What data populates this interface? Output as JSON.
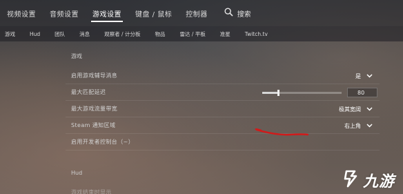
{
  "top_nav": {
    "tabs": [
      {
        "label": "视频设置",
        "active": false
      },
      {
        "label": "音频设置",
        "active": false
      },
      {
        "label": "游戏设置",
        "active": true
      },
      {
        "label": "键盘 / 鼠标",
        "active": false
      },
      {
        "label": "控制器",
        "active": false
      }
    ],
    "search_label": "搜索"
  },
  "sub_nav": {
    "tabs": [
      "游戏",
      "Hud",
      "团队",
      "消息",
      "观察者 / 计分板",
      "物品",
      "雷达 / 平板",
      "准星",
      "Twitch.tv"
    ]
  },
  "sections": {
    "game_title": "游戏",
    "hud_title": "Hud"
  },
  "settings": [
    {
      "label": "启用游戏辅导消息",
      "value": "是",
      "has_dropdown": true
    },
    {
      "label": "最大匹配延迟",
      "value": "80",
      "slider_fraction": 0.2
    },
    {
      "label": "最大游戏流量带宽",
      "value": "极其宽阔",
      "has_dropdown": true
    },
    {
      "label": "Steam 通知区域",
      "value": "右上角",
      "has_dropdown": true
    },
    {
      "label": "启用开发者控制台（~）",
      "value": "",
      "has_dropdown": false
    }
  ],
  "hud_settings": [
    {
      "label": "游戏结束时显示"
    }
  ],
  "watermark": {
    "text": "九游"
  },
  "colors": {
    "accent": "#ffffff",
    "annotation": "#d11a1a",
    "watermark": "#ffffff"
  }
}
